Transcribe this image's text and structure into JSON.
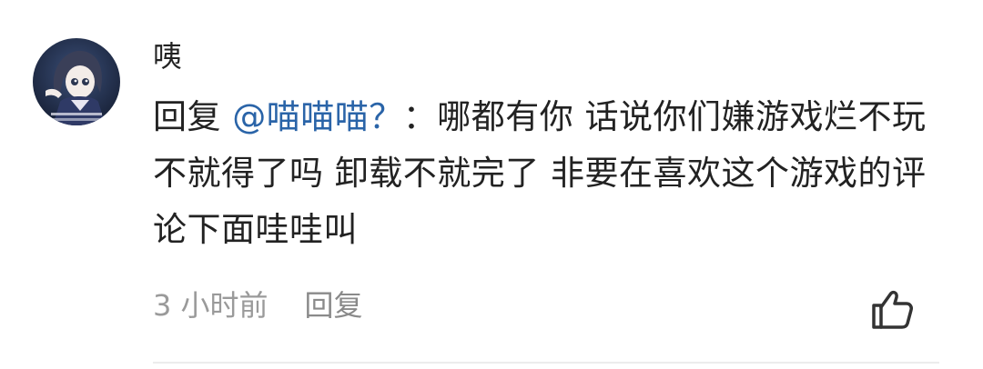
{
  "comment": {
    "username": "咦",
    "reply_prefix": "回复 ",
    "mention": "@喵喵喵？",
    "separator": "：",
    "text": "哪都有你 话说你们嫌游戏烂不玩不就得了吗 卸载不就完了 非要在喜欢这个游戏的评论下面哇哇叫",
    "time": "3 小时前",
    "reply_label": "回复",
    "avatar_icon": "anime-girl-avatar",
    "like_icon": "thumbs-up-icon",
    "mention_color": "#2a64a8"
  }
}
